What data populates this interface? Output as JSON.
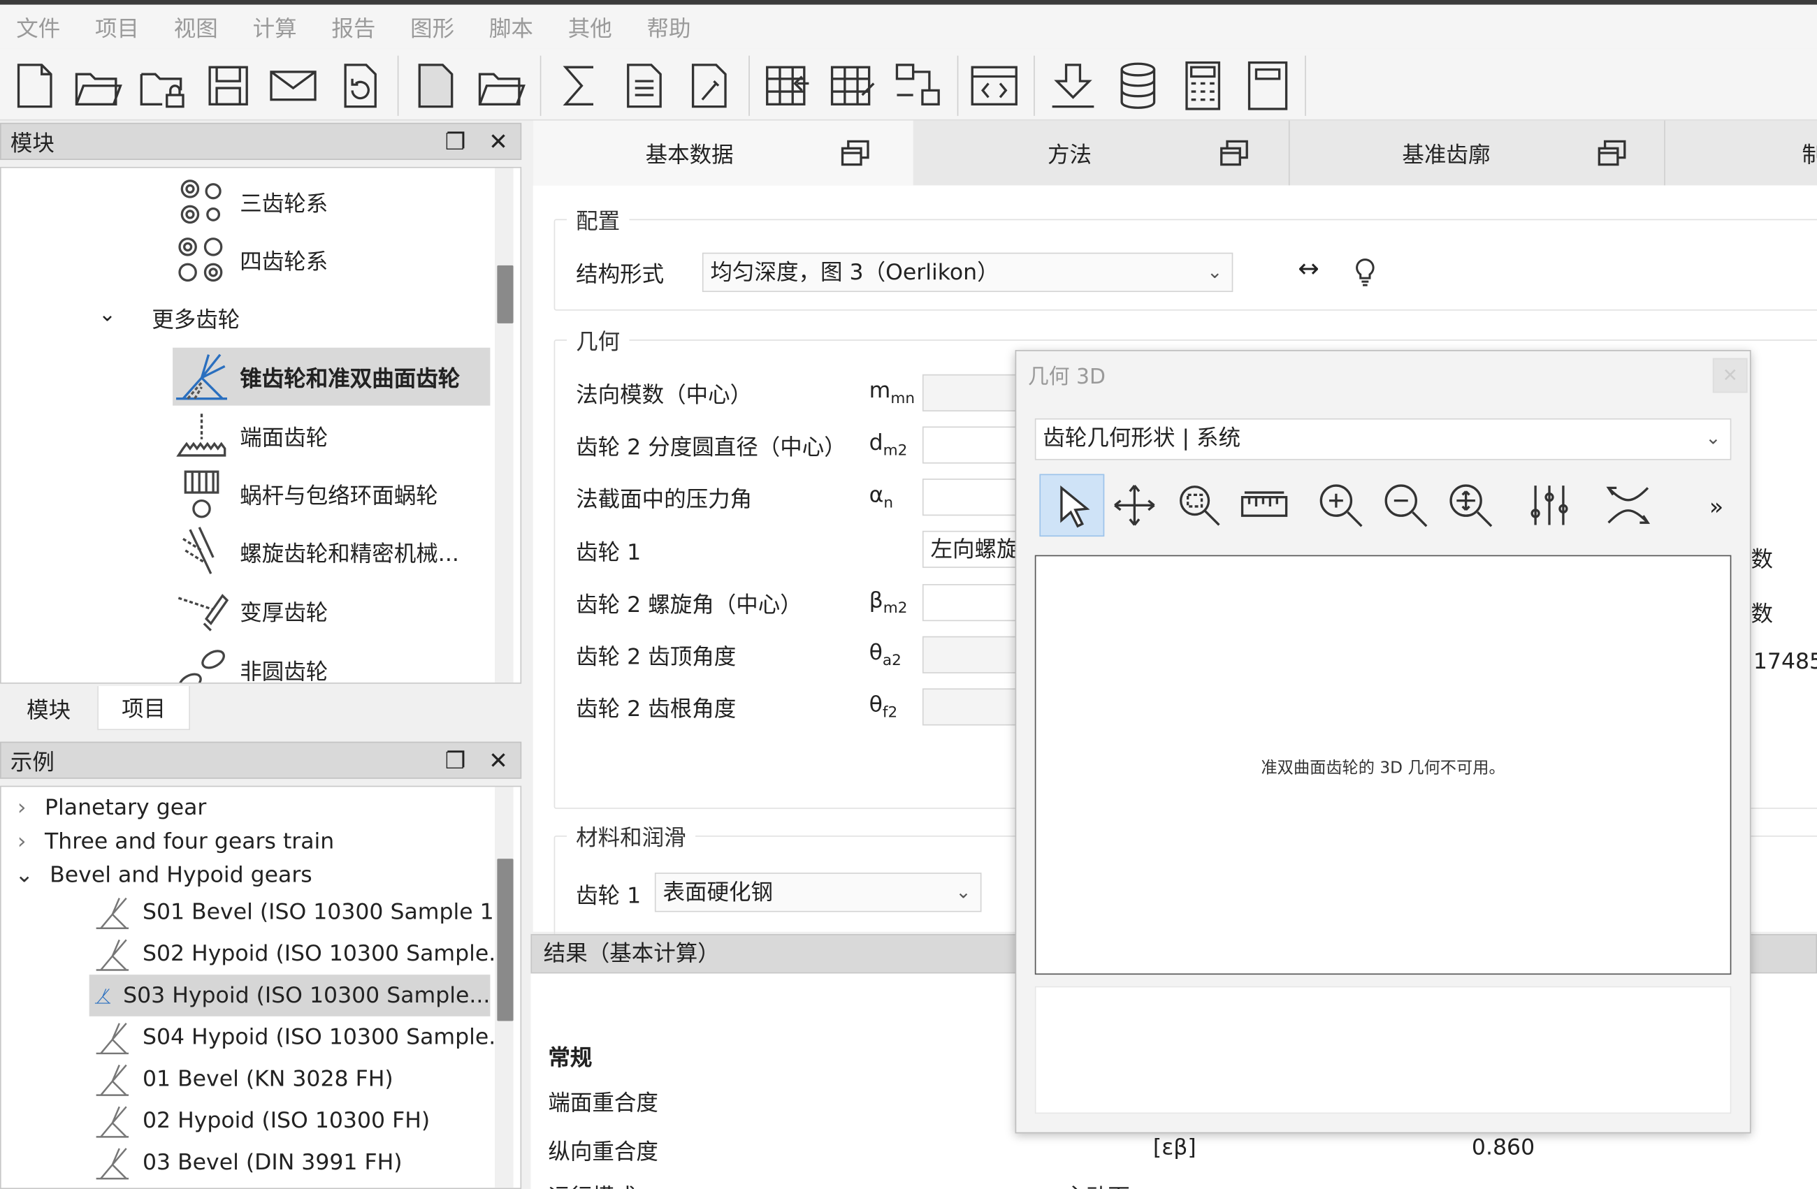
{
  "menu": [
    "文件",
    "项目",
    "视图",
    "计算",
    "报告",
    "图形",
    "脚本",
    "其他",
    "帮助"
  ],
  "toolbar_icons": [
    "new-file-icon",
    "open-folder-icon",
    "open-locked-icon",
    "save-icon",
    "email-icon",
    "undo-icon",
    "new-doc-icon",
    "folder-icon",
    "sigma-icon",
    "report-icon",
    "edit-doc-icon",
    "grid-arrow-icon",
    "grid-edit-icon",
    "flow-icon",
    "code-window-icon",
    "download-icon",
    "database-icon",
    "calculator-icon",
    "window-icon"
  ],
  "modules_panel": {
    "title": "模块",
    "items": [
      {
        "label": "三齿轮系",
        "icon": "three-gears-icon"
      },
      {
        "label": "四齿轮系",
        "icon": "four-gears-icon"
      },
      {
        "label": "锥齿轮和准双曲面齿轮",
        "icon": "bevel-gear-icon"
      },
      {
        "label": "端面齿轮",
        "icon": "face-gear-icon"
      },
      {
        "label": "蜗杆与包络环面蜗轮",
        "icon": "worm-gear-icon"
      },
      {
        "label": "螺旋齿轮和精密机械...",
        "icon": "helical-gear-icon"
      },
      {
        "label": "变厚齿轮",
        "icon": "beveloid-gear-icon"
      },
      {
        "label": "非圆齿轮",
        "icon": "noncircular-gear-icon"
      }
    ],
    "group": "更多齿轮"
  },
  "bottom_tabs": [
    "模块",
    "项目"
  ],
  "examples_panel": {
    "title": "示例",
    "groups": [
      "Planetary gear",
      "Three and four gears train",
      "Bevel and Hypoid gears"
    ],
    "items": [
      "S01 Bevel (ISO 10300 Sample 1...",
      "S02 Hypoid (ISO 10300 Sample...",
      "S03 Hypoid (ISO 10300 Sample...",
      "S04 Hypoid (ISO 10300 Sample...",
      "01 Bevel (KN 3028 FH)",
      "02 Hypoid (ISO 10300 FH)",
      "03 Bevel (DIN 3991 FH)"
    ]
  },
  "main_tabs": [
    "基本数据",
    "方法",
    "基准齿廓",
    "制"
  ],
  "config": {
    "legend": "配置",
    "structure_label": "结构形式",
    "structure_value": "均匀深度，图 3（Oerlikon）"
  },
  "geometry": {
    "legend": "几何",
    "rows": [
      {
        "label": "法向模数（中心）",
        "sym": "m",
        "sub": "mn"
      },
      {
        "label": "齿轮 2 分度圆直径（中心）",
        "sym": "d",
        "sub": "m2"
      },
      {
        "label": "法截面中的压力角",
        "sym": "α",
        "sub": "n"
      },
      {
        "label": "齿轮 1",
        "sym": "",
        "sub": ""
      },
      {
        "label": "齿轮 2 螺旋角（中心）",
        "sym": "β",
        "sub": "m2"
      },
      {
        "label": "齿轮 2 齿顶角度",
        "sym": "θ",
        "sub": "a2"
      },
      {
        "label": "齿轮 2 齿根角度",
        "sym": "θ",
        "sub": "f2"
      }
    ],
    "gear1_value": "左向螺旋",
    "right_texts": [
      "数",
      "数",
      "17485"
    ]
  },
  "material": {
    "legend": "材料和润滑",
    "gear1_label": "齿轮 1",
    "gear1_value": "表面硬化钢"
  },
  "results": {
    "title": "结果（基本计算）",
    "section": "常规",
    "rows": [
      {
        "label": "端面重合度",
        "sym": "",
        "value": ""
      },
      {
        "label": "纵向重合度",
        "sym": "[εβ]",
        "value": "0.860"
      }
    ],
    "cut_label": "运行模式",
    "cut_right": "主动面"
  },
  "dialog": {
    "title": "几何 3D",
    "combo": "齿轮几何形状 | 系统",
    "message": "准双曲面齿轮的 3D 几何不可用。",
    "more": "»",
    "tools": [
      "pointer-icon",
      "move-icon",
      "zoom-window-icon",
      "ruler-icon",
      "zoom-in-icon",
      "zoom-out-icon",
      "zoom-fit-icon",
      "sliders-icon",
      "section-icon"
    ]
  }
}
